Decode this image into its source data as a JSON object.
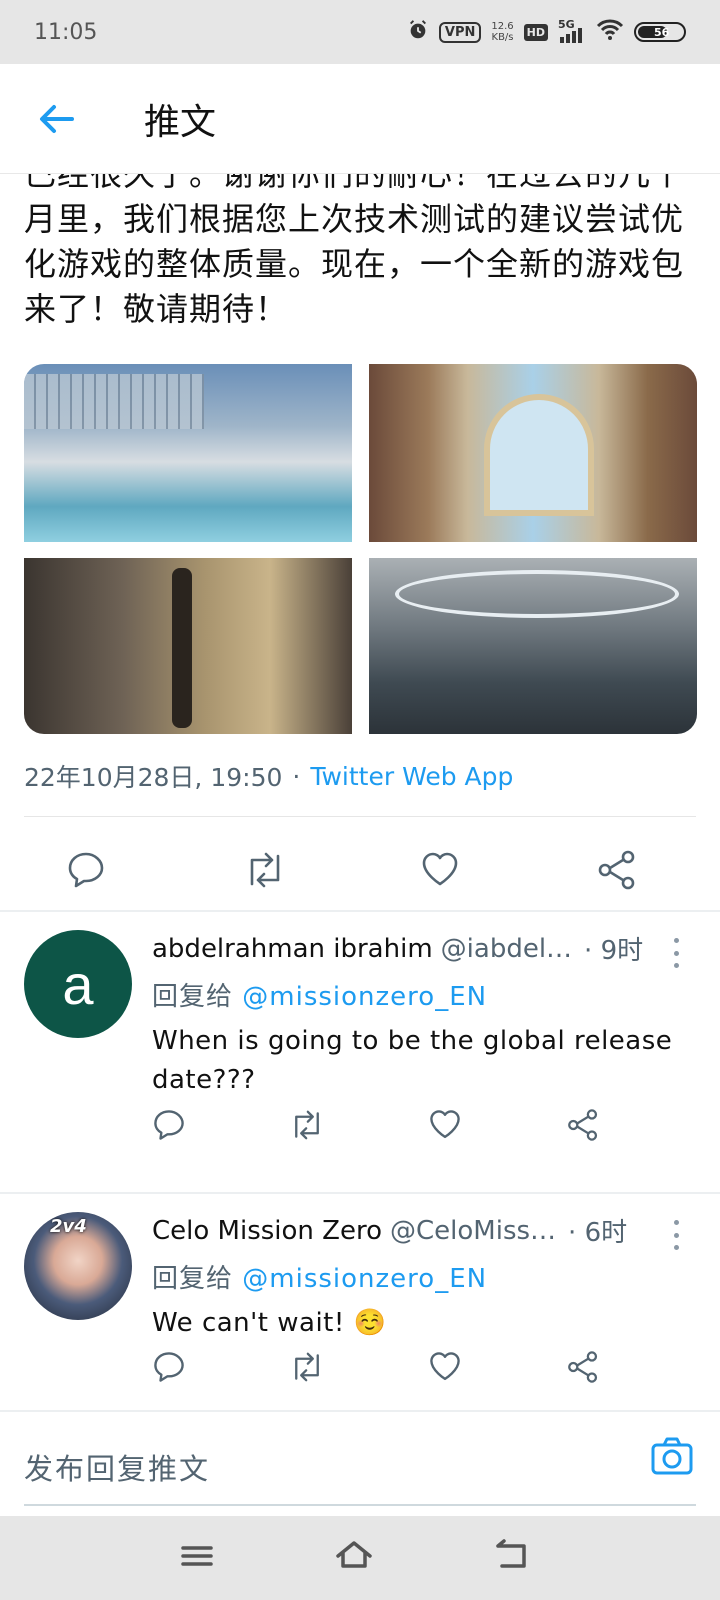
{
  "status_bar": {
    "time": "11:05",
    "vpn": "VPN",
    "speed_value": "12.6",
    "speed_unit": "KB/s",
    "hd": "HD",
    "network": "5G",
    "battery": "56"
  },
  "header": {
    "title": "推文"
  },
  "tweet": {
    "text": "已经很久了。谢谢你们的耐心！在过去的几个月里，我们根据您上次技术测试的建议尝试优化游戏的整体质量。现在，一个全新的游戏包来了！敬请期待！",
    "date": "22年10月28日, 19:50",
    "separator": "·",
    "source": "Twitter Web App"
  },
  "replies": [
    {
      "avatar_letter": "a",
      "name": "abdelrahman ibrahim",
      "handle": "@iabdel…",
      "time": "· 9时",
      "reply_label": "回复给",
      "mention": "@missionzero_EN",
      "text": "When is going to be the global release date???"
    },
    {
      "avatar_logo": "2v4",
      "name": "Celo Mission Zero",
      "handle": "@CeloMiss…",
      "time": "· 6时",
      "reply_label": "回复给",
      "mention": "@missionzero_EN",
      "text": "We can't wait! ☺️"
    }
  ],
  "compose": {
    "placeholder": "发布回复推文"
  },
  "colors": {
    "accent": "#1d9bf0",
    "secondary_text": "#536471",
    "avatar_bg": "#0d5547"
  }
}
